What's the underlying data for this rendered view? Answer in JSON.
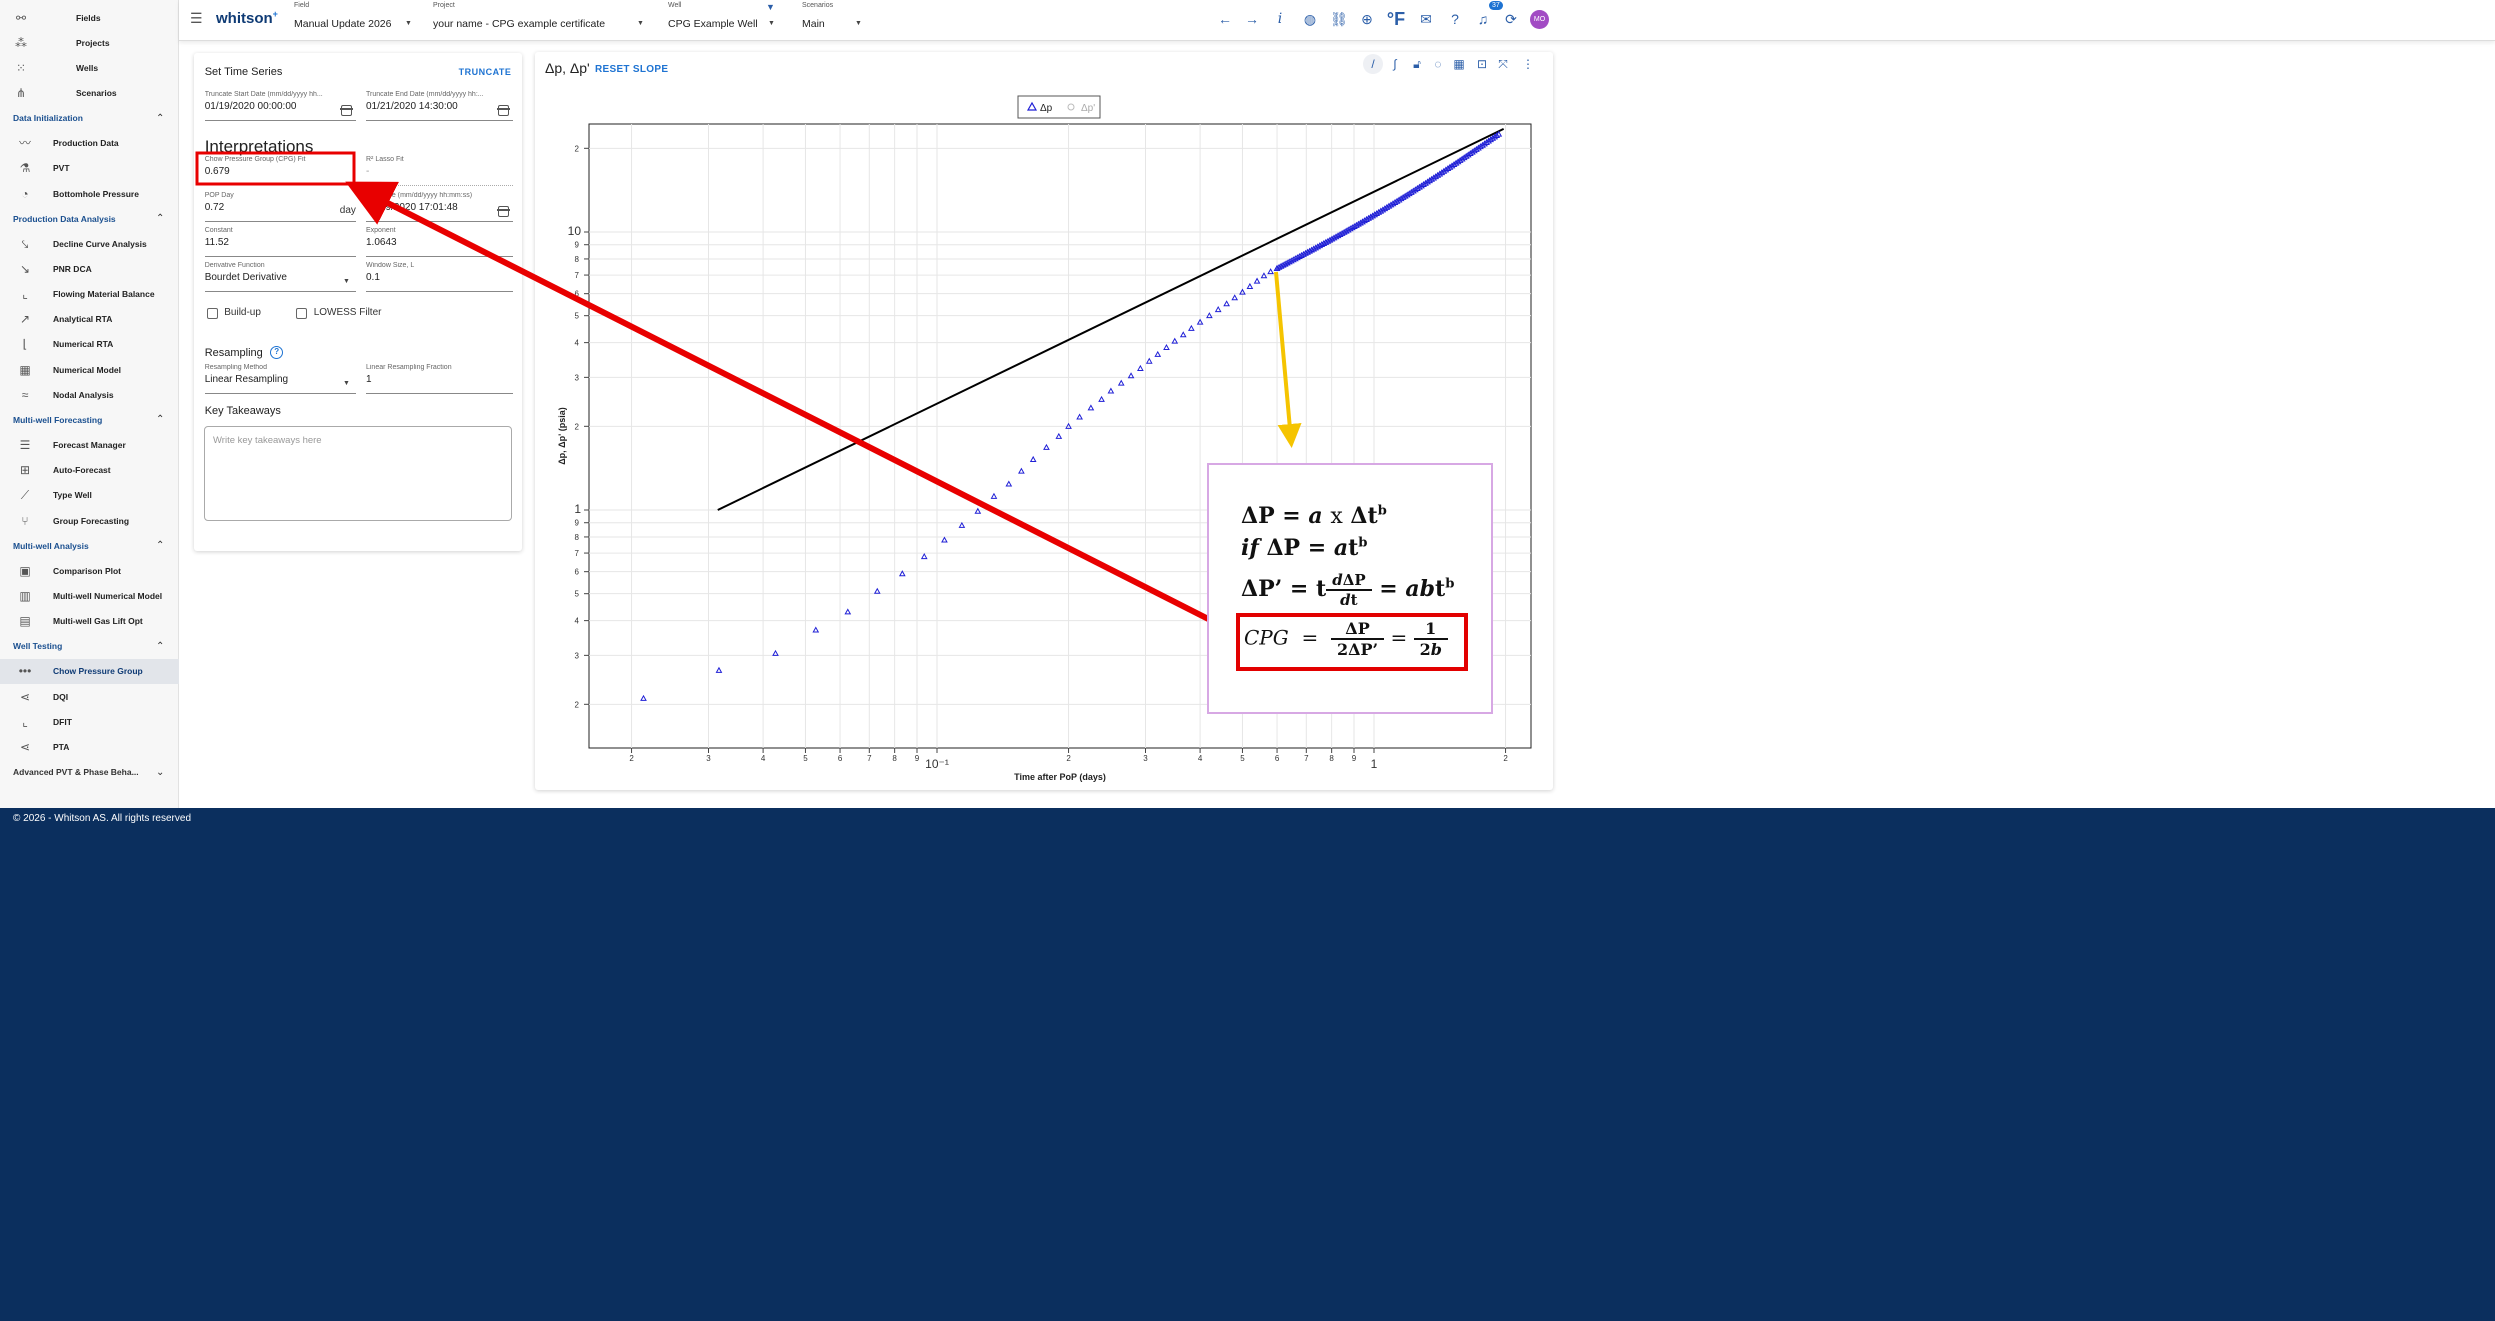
{
  "app": {
    "brand": "whitson",
    "brand_sup": "+",
    "footer": "© 2026 - Whitson AS. All rights reserved"
  },
  "header": {
    "field_caption": "Field",
    "field_value": "Manual Update 2026",
    "project_caption": "Project",
    "project_value": "your name - CPG example certificate",
    "well_caption": "Well",
    "well_value": "CPG Example Well",
    "scenario_caption": "Scenarios",
    "scenario_value": "Main",
    "notification_count": "37",
    "avatar_initials": "MO",
    "info_glyph": "i",
    "temp_unit": "°F",
    "icons": [
      "back-arrow-icon",
      "forward-arrow-icon",
      "info-icon",
      "globe-icon",
      "link-icon",
      "download-icon",
      "temperature-unit-icon",
      "feedback-icon",
      "help-icon",
      "notifications-icon",
      "refresh-icon"
    ]
  },
  "sidebar": {
    "top_items": [
      {
        "label": "Fields",
        "icon": "fields-icon"
      },
      {
        "label": "Projects",
        "icon": "projects-icon"
      },
      {
        "label": "Wells",
        "icon": "wells-icon"
      },
      {
        "label": "Scenarios",
        "icon": "scenarios-icon"
      }
    ],
    "sections": [
      {
        "title": "Data Initialization",
        "items": [
          "Production Data",
          "PVT",
          "Bottomhole Pressure"
        ]
      },
      {
        "title": "Production Data Analysis",
        "items": [
          "Decline Curve Analysis",
          "PNR DCA",
          "Flowing Material Balance",
          "Analytical RTA",
          "Numerical RTA",
          "Numerical Model",
          "Nodal Analysis"
        ]
      },
      {
        "title": "Multi-well Forecasting",
        "items": [
          "Forecast Manager",
          "Auto-Forecast",
          "Type Well",
          "Group Forecasting"
        ]
      },
      {
        "title": "Multi-well Analysis",
        "items": [
          "Comparison Plot",
          "Multi-well Numerical Model",
          "Multi-well Gas Lift Opt"
        ]
      },
      {
        "title": "Well Testing",
        "items": [
          "Chow Pressure Group",
          "DQI",
          "DFIT",
          "PTA"
        ]
      },
      {
        "title": "Advanced PVT & Phase Beha...",
        "items": []
      }
    ],
    "active_item": "Chow Pressure Group"
  },
  "settings": {
    "title": "Set Time Series",
    "truncate_button": "TRUNCATE",
    "truncate_start_caption": "Truncate Start Date (mm/dd/yyyy hh...",
    "truncate_start_value": "01/19/2020 00:00:00",
    "truncate_end_caption": "Truncate End Date (mm/dd/yyyy hh:...",
    "truncate_end_value": "01/21/2020 14:30:00",
    "interpretations_title": "Interpretations",
    "cpg_fit_caption": "Chow Pressure Group (CPG) Fit",
    "cpg_fit_value": "0.679",
    "lasso_caption": "R² Lasso Fit",
    "lasso_value": "-",
    "pop_day_caption": "POP Day",
    "pop_day_value": "0.72",
    "pop_day_unit": "day",
    "pop_time_caption": "POP time (mm/dd/yyyy hh:mm:ss)",
    "pop_time_value": "01/19/2020 17:01:48",
    "constant_caption": "Constant",
    "constant_value": "11.52",
    "exponent_caption": "Exponent",
    "exponent_value": "1.0643",
    "derivative_caption": "Derivative Function",
    "derivative_value": "Bourdet Derivative",
    "window_caption": "Window Size, L",
    "window_value": "0.1",
    "buildup_label": "Build-up",
    "lowess_label": "LOWESS Filter",
    "resampling_title": "Resampling",
    "resampling_method_caption": "Resampling Method",
    "resampling_method_value": "Linear Resampling",
    "resampling_fraction_caption": "Linear Resampling Fraction",
    "resampling_fraction_value": "1",
    "takeaways_title": "Key Takeaways",
    "takeaways_placeholder": "Write key takeaways here"
  },
  "chart_header": {
    "title": "Δp, Δp'",
    "reset_slope": "RESET SLOPE",
    "tool_icons": [
      "line-tool-icon",
      "curve-tool-icon",
      "unlock-icon",
      "lasso-icon",
      "table-icon",
      "fit-icon",
      "zoom-icon",
      "more-icon"
    ]
  },
  "chart_data": {
    "type": "scatter",
    "xscale": "log",
    "yscale": "log",
    "xlim": [
      0.016,
      2.1
    ],
    "ylim": [
      0.17,
      2.6
    ],
    "xlabel": "Time after PoP (days)",
    "ylabel": "Δp, Δp' (psia)",
    "legend": [
      {
        "name": "Δp",
        "marker": "triangle",
        "color": "#1f1fd6",
        "visible": true
      },
      {
        "name": "Δp'",
        "marker": "circle",
        "color": "#bbbbbb",
        "visible": false
      }
    ],
    "legend_placement": "top-center",
    "grid": true,
    "x_ticks": [
      {
        "v": 0.02,
        "label": "2"
      },
      {
        "v": 0.03,
        "label": "3"
      },
      {
        "v": 0.04,
        "label": "4"
      },
      {
        "v": 0.05,
        "label": "5"
      },
      {
        "v": 0.06,
        "label": "6"
      },
      {
        "v": 0.07,
        "label": "7"
      },
      {
        "v": 0.08,
        "label": "8"
      },
      {
        "v": 0.09,
        "label": "9"
      },
      {
        "v": 0.1,
        "label": "10⁻¹"
      },
      {
        "v": 0.2,
        "label": "2"
      },
      {
        "v": 0.3,
        "label": "3"
      },
      {
        "v": 0.4,
        "label": "4"
      },
      {
        "v": 0.5,
        "label": "5"
      },
      {
        "v": 0.6,
        "label": "6"
      },
      {
        "v": 0.7,
        "label": "7"
      },
      {
        "v": 0.8,
        "label": "8"
      },
      {
        "v": 0.9,
        "label": "9"
      },
      {
        "v": 1,
        "label": "1"
      },
      {
        "v": 2,
        "label": "2"
      }
    ],
    "y_ticks": [
      {
        "v": 0.2,
        "label": "2"
      },
      {
        "v": 0.3,
        "label": "3"
      },
      {
        "v": 0.4,
        "label": "4"
      },
      {
        "v": 0.5,
        "label": "5"
      },
      {
        "v": 0.6,
        "label": "6"
      },
      {
        "v": 0.7,
        "label": "7"
      },
      {
        "v": 0.8,
        "label": "8"
      },
      {
        "v": 0.9,
        "label": "9"
      },
      {
        "v": 1,
        "label": "1"
      },
      {
        "v": 2,
        "label": "2"
      },
      {
        "v": 3,
        "label": "3"
      },
      {
        "v": 4,
        "label": "4"
      },
      {
        "v": 5,
        "label": "5"
      },
      {
        "v": 6,
        "label": "6"
      },
      {
        "v": 7,
        "label": "7"
      },
      {
        "v": 8,
        "label": "8"
      },
      {
        "v": 9,
        "label": "9"
      },
      {
        "v": 10,
        "label": "10"
      },
      {
        "v": 20,
        "label": "2"
      }
    ],
    "note": "y-axis tick labels shown as printed; major label 10 and 1",
    "series": [
      {
        "name": "Δp",
        "x": [
          0.0213,
          0.0317,
          0.0427,
          0.0528,
          0.0625,
          0.073,
          0.0833,
          0.0935,
          0.104,
          0.114,
          0.124,
          0.135,
          0.146,
          0.156,
          0.166,
          0.178,
          0.19,
          0.2,
          0.212,
          0.225,
          0.238,
          0.25,
          0.264,
          0.278,
          0.292,
          0.306,
          0.32,
          0.335,
          0.35,
          0.366,
          0.382,
          0.4,
          0.42,
          0.44,
          0.46,
          0.48,
          0.5,
          0.52,
          0.54,
          0.56,
          0.58,
          0.6
        ],
        "y": [
          0.21,
          0.265,
          0.305,
          0.37,
          0.43,
          0.51,
          0.59,
          0.68,
          0.78,
          0.88,
          0.99,
          1.12,
          1.24,
          1.38,
          1.52,
          1.68,
          1.84,
          2.0,
          2.16,
          2.33,
          2.5,
          2.68,
          2.86,
          3.04,
          3.23,
          3.43,
          3.63,
          3.84,
          4.05,
          4.27,
          4.5,
          4.74,
          5.0,
          5.26,
          5.52,
          5.8,
          6.08,
          6.37,
          6.66,
          6.96,
          7.2,
          7.4
        ]
      },
      {
        "name": "Δp dense",
        "x_start": 0.6,
        "x_end": 1.93,
        "y_start": 7.4,
        "y_end": 22.5,
        "count": 110
      }
    ],
    "fit_line": {
      "x": [
        0.0315,
        1.98
      ],
      "y": [
        1.0,
        23.5
      ],
      "color": "#000000"
    }
  },
  "annotation": {
    "arrow_color": "#e80000",
    "yellow_arrow_color": "#f5c400",
    "formula_lines": [
      "ΔP = a x Δt^b",
      "if ΔP = at^b",
      "ΔP' = t dΔP/dt = abt^b",
      "CPG = ΔP/2ΔP' = 1/2b"
    ]
  }
}
